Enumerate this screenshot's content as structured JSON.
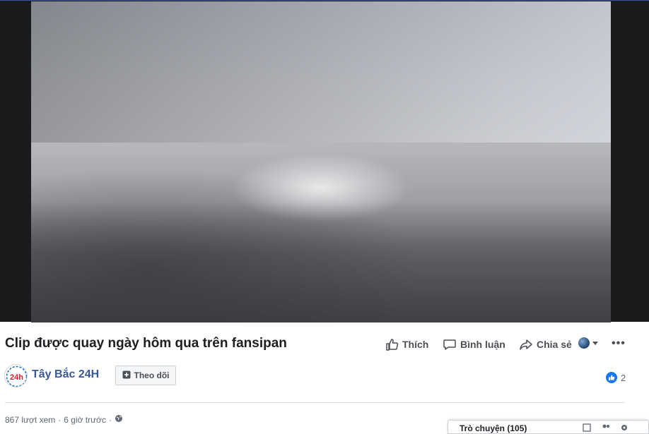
{
  "video": {
    "title": "Clip được quay ngày hôm qua trên fansipan"
  },
  "actions": {
    "like_label": "Thích",
    "comment_label": "Bình luận",
    "share_label": "Chia sẻ",
    "more_label": "•••"
  },
  "page": {
    "name": "Tây Bắc 24H",
    "logo_text": "24h",
    "follow_label": "Theo dõi"
  },
  "reactions": {
    "count": "2"
  },
  "meta": {
    "views": "867 lượt xem",
    "separator": "·",
    "time": "6 giờ trước",
    "separator2": "·"
  },
  "side_panel": {
    "text": "Trò chuyện (105)"
  },
  "colors": {
    "link": "#385898",
    "like_blue": "#1877f2",
    "player_bg": "#1a1b1d"
  },
  "icons": [
    "thumbs-up-icon",
    "comment-icon",
    "share-icon",
    "globe-icon",
    "chevron-down-icon",
    "plus-square-icon",
    "like-reaction-icon"
  ]
}
